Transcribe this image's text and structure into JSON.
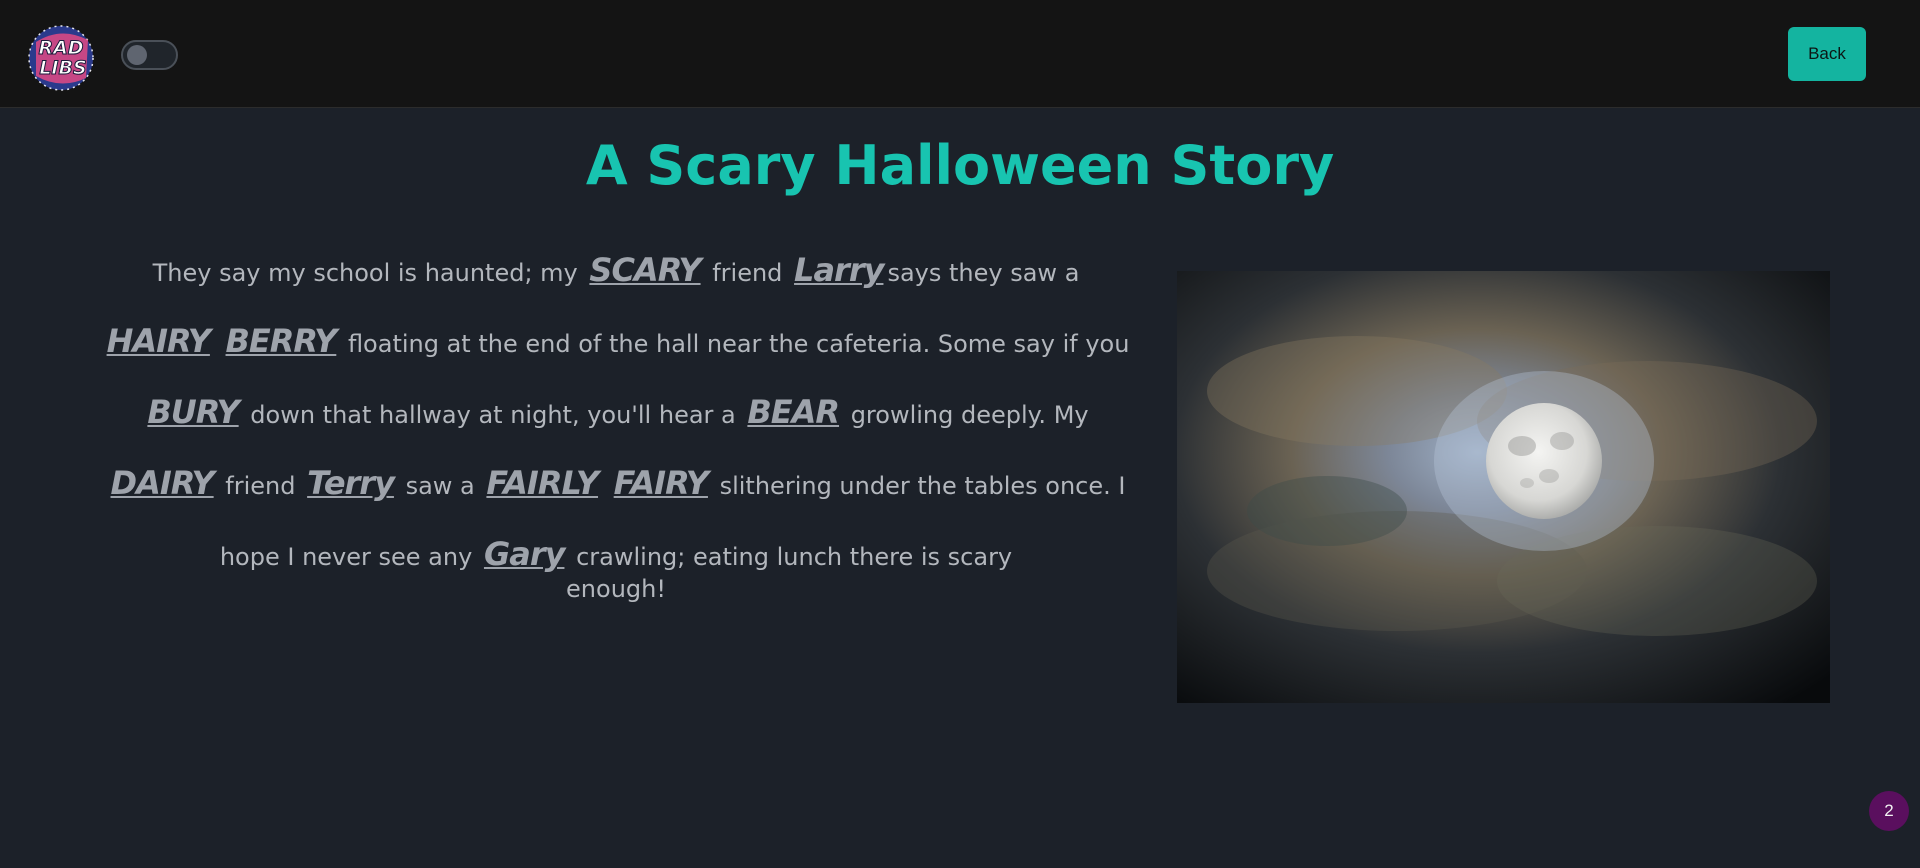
{
  "header": {
    "logo": {
      "line1": "RAD",
      "line2": "LIBS"
    },
    "back_label": "Back"
  },
  "story": {
    "title": "A Scary Halloween Story",
    "text": {
      "t1": "They say my school is haunted; my",
      "w1": "Scary",
      "t2": "friend",
      "w2": "Larry",
      "t3": "says they saw a",
      "w3": "Hairy",
      "w4": "Berry",
      "t4": "floating at the end of the hall near the cafeteria. Some say if you",
      "w5": "Bury",
      "t5": "down that hallway at night, you'll hear a",
      "w6": "Bear",
      "t6": "growling deeply. My",
      "w7": "Dairy",
      "t7": "friend",
      "w8": "Terry",
      "t8": "saw a",
      "w9": "Fairly",
      "w10": "Fairy",
      "t9": "slithering under the tables once. I hope I never see any",
      "w11": "Gary",
      "t10": "crawling; eating lunch there is scary",
      "t11": "enough!"
    }
  },
  "badge": "2",
  "colors": {
    "accent": "#18c4b0",
    "background": "#1c2129",
    "topbar": "#141414",
    "badge": "#5a0f5e"
  }
}
